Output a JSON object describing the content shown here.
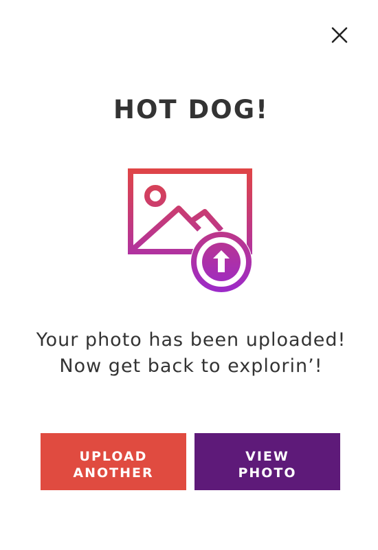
{
  "modal": {
    "title": "HOT DOG!",
    "message_line1": "Your photo has been uploaded!",
    "message_line2": "Now get back to explorin’!",
    "illustration_icon": "image-upload-icon",
    "close_icon": "close-icon"
  },
  "buttons": {
    "upload_another": {
      "line1": "UPLOAD",
      "line2": "ANOTHER",
      "color": "#e04b40"
    },
    "view_photo": {
      "line1": "VIEW",
      "line2": "PHOTO",
      "color": "#5e1a79"
    }
  },
  "colors": {
    "gradient_top": "#e04545",
    "gradient_bottom": "#9b2ac9",
    "text": "#333333"
  }
}
